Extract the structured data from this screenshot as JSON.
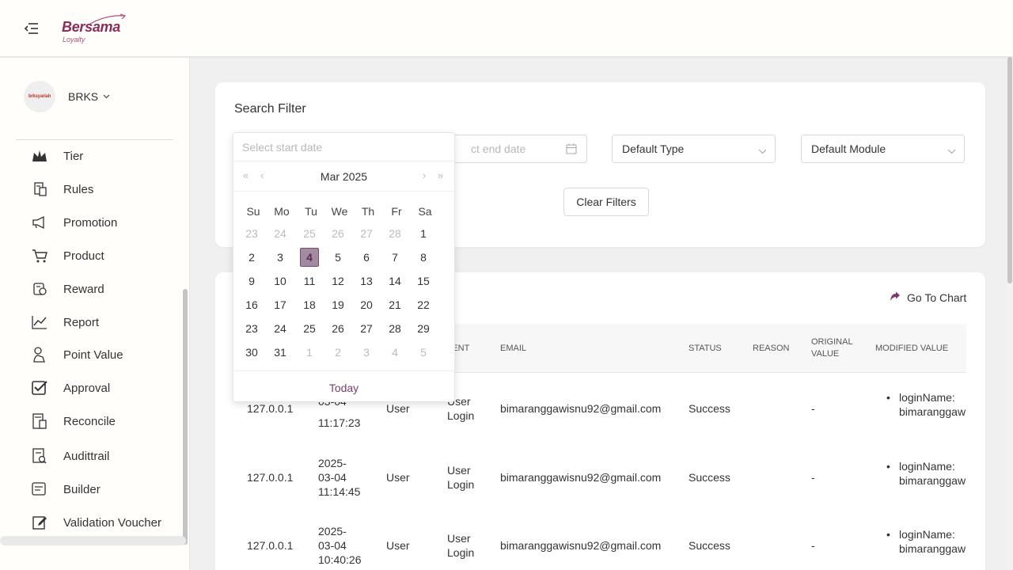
{
  "header": {
    "logo_text": "Bersama",
    "logo_sub": "Loyalty",
    "menu_icon": "menu-collapse-icon"
  },
  "sidebar": {
    "org": {
      "name": "BRKS",
      "avatar_text": "brksyariah"
    },
    "items": [
      {
        "label": "Tier",
        "icon": "crown-icon"
      },
      {
        "label": "Rules",
        "icon": "rules-icon"
      },
      {
        "label": "Promotion",
        "icon": "megaphone-icon"
      },
      {
        "label": "Product",
        "icon": "cart-icon"
      },
      {
        "label": "Reward",
        "icon": "reward-icon"
      },
      {
        "label": "Report",
        "icon": "chart-line-icon"
      },
      {
        "label": "Point Value",
        "icon": "point-value-icon"
      },
      {
        "label": "Approval",
        "icon": "checkbox-icon"
      },
      {
        "label": "Reconcile",
        "icon": "calculator-icon"
      },
      {
        "label": "Audittrail",
        "icon": "audit-icon"
      },
      {
        "label": "Builder",
        "icon": "builder-icon"
      },
      {
        "label": "Validation Voucher",
        "icon": "edit-voucher-icon"
      }
    ]
  },
  "filter": {
    "title": "Search Filter",
    "start_placeholder": "Select start date",
    "end_placeholder_visible": "ct end date",
    "type_value": "Default Type",
    "module_value": "Default Module",
    "clear_label": "Clear Filters"
  },
  "table": {
    "go_chart_label": "Go To Chart",
    "columns": {
      "event": "VENT",
      "email": "EMAIL",
      "status": "STATUS",
      "reason": "REASON",
      "original_value_1": "ORIGINAL",
      "original_value_2": "VALUE",
      "modified_value": "MODIFIED VALUE"
    },
    "rows": [
      {
        "ip": "127.0.0.1",
        "date1": "",
        "date2": "03-04",
        "date3": "11:17:23",
        "type": "User",
        "event1": "User",
        "event2": "Login",
        "email": "bimaranggawisnu92@gmail.com",
        "status": "Success",
        "reason": "",
        "original": "-",
        "mod1": "loginName:",
        "mod2": "bimaranggaw"
      },
      {
        "ip": "127.0.0.1",
        "date1": "2025-",
        "date2": "03-04",
        "date3": "11:14:45",
        "type": "User",
        "event1": "User",
        "event2": "Login",
        "email": "bimaranggawisnu92@gmail.com",
        "status": "Success",
        "reason": "",
        "original": "-",
        "mod1": "loginName:",
        "mod2": "bimaranggaw"
      },
      {
        "ip": "127.0.0.1",
        "date1": "2025-",
        "date2": "03-04",
        "date3": "10:40:26",
        "type": "User",
        "event1": "User",
        "event2": "Login",
        "email": "bimaranggawisnu92@gmail.com",
        "status": "Success",
        "reason": "",
        "original": "-",
        "mod1": "loginName:",
        "mod2": "bimaranggaw"
      }
    ]
  },
  "datepicker": {
    "placeholder": "Select start date",
    "month_label": "Mar 2025",
    "weekdays": [
      "Su",
      "Mo",
      "Tu",
      "We",
      "Th",
      "Fr",
      "Sa"
    ],
    "weeks": [
      [
        "23",
        "24",
        "25",
        "26",
        "27",
        "28",
        "1"
      ],
      [
        "2",
        "3",
        "4",
        "5",
        "6",
        "7",
        "8"
      ],
      [
        "9",
        "10",
        "11",
        "12",
        "13",
        "14",
        "15"
      ],
      [
        "16",
        "17",
        "18",
        "19",
        "20",
        "21",
        "22"
      ],
      [
        "23",
        "24",
        "25",
        "26",
        "27",
        "28",
        "29"
      ],
      [
        "30",
        "31",
        "1",
        "2",
        "3",
        "4",
        "5"
      ]
    ],
    "selected_day": "4",
    "today_label": "Today",
    "nav": {
      "super_prev": "«",
      "prev": "‹",
      "next": "›",
      "super_next": "»"
    }
  },
  "colors": {
    "brand": "#8c2c58",
    "selected_day_bg": "#a28aa0",
    "today_link": "#7a3a6e"
  }
}
